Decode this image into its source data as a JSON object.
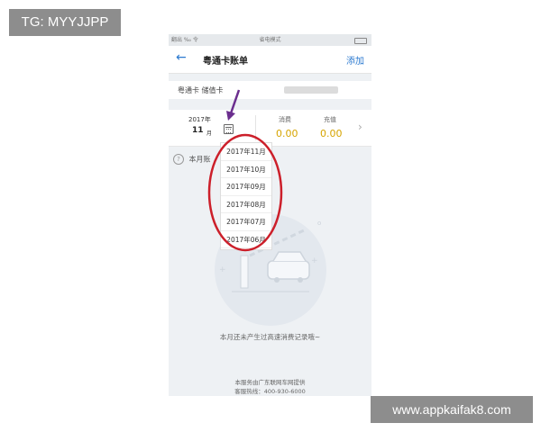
{
  "watermarks": {
    "top_left": "TG: MYYJJPP",
    "bottom_right": "www.appkaifak8.com"
  },
  "statusbar": {
    "left": "翻出 ‰ 令",
    "center": "省电模式"
  },
  "navbar": {
    "title": "粤通卡账单",
    "add_label": "添加",
    "back_icon": "arrow-left-icon"
  },
  "card": {
    "label": "粤通卡 储值卡"
  },
  "summary": {
    "year": "2017年",
    "month": "11",
    "month_suffix": "月",
    "spend_label": "消费",
    "spend_value": "0.00",
    "recharge_label": "充值",
    "recharge_value": "0.00"
  },
  "info": {
    "text": "本月账"
  },
  "month_dropdown": {
    "options": [
      "2017年11月",
      "2017年10月",
      "2017年09月",
      "2017年08月",
      "2017年07月",
      "2017年06月"
    ]
  },
  "empty_message": "本月还未产生过高速消费记录哦~",
  "footer": {
    "line1": "本服务由广东联网车网提供",
    "line2": "客服热线：400-930-6000"
  },
  "colors": {
    "accent": "#2c7ad0",
    "value": "#d6a400",
    "annotation_red": "#cc1f2a",
    "annotation_arrow": "#6b2e8e"
  }
}
